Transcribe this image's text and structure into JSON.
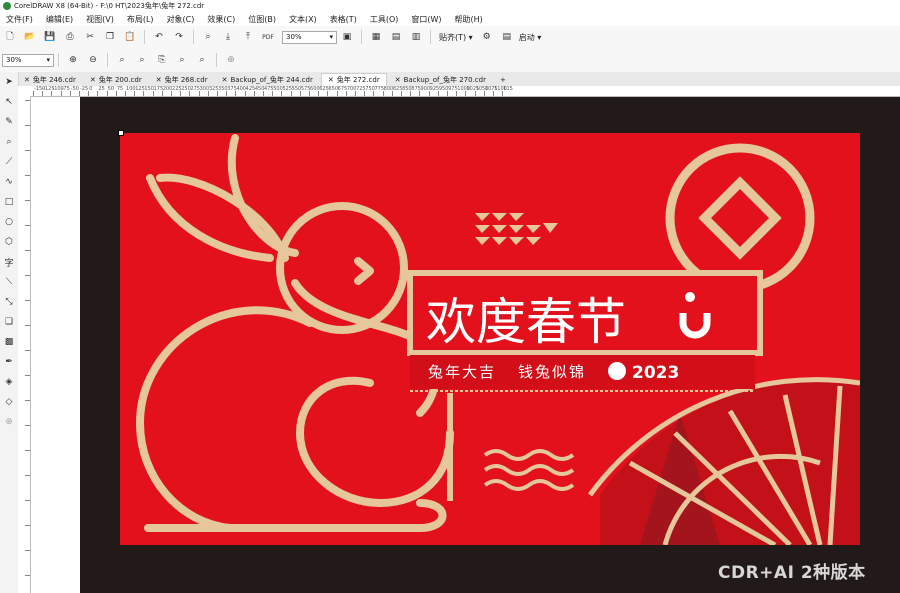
{
  "window": {
    "title": "CorelDRAW X8 (64-Bit) - F:\\0 HT\\2023兔年\\兔年 272.cdr"
  },
  "menu": [
    "文件(F)",
    "编辑(E)",
    "视图(V)",
    "布局(L)",
    "对象(C)",
    "效果(C)",
    "位图(B)",
    "文本(X)",
    "表格(T)",
    "工具(O)",
    "窗口(W)",
    "帮助(H)"
  ],
  "toolbar": {
    "zoom_value": "30%",
    "snap_label": "贴齐(T)",
    "launch_label": "启动",
    "pdf_label": "PDF"
  },
  "property_bar": {
    "zoom_value": "30%"
  },
  "tabs": [
    {
      "label": "兔年 246.cdr",
      "active": false
    },
    {
      "label": "兔年 200.cdr",
      "active": false
    },
    {
      "label": "兔年 268.cdr",
      "active": false
    },
    {
      "label": "Backup_of_兔年 244.cdr",
      "active": false
    },
    {
      "label": "兔年 272.cdr",
      "active": true
    },
    {
      "label": "Backup_of_兔年 270.cdr",
      "active": false
    }
  ],
  "ruler": {
    "ticks": [
      "-150",
      "-125",
      "-100",
      "-75",
      "-50",
      "-25",
      "0",
      "25",
      "50",
      "75",
      "100",
      "125",
      "150",
      "175",
      "200",
      "225",
      "250",
      "275",
      "300",
      "325",
      "350",
      "375",
      "400",
      "425",
      "450",
      "475",
      "500",
      "525",
      "550",
      "575",
      "600",
      "625",
      "650",
      "675",
      "700",
      "725",
      "750",
      "775",
      "800",
      "825",
      "850",
      "875",
      "900",
      "925",
      "950",
      "975",
      "1000",
      "1025",
      "1050",
      "1075",
      "1100",
      "115"
    ]
  },
  "artwork": {
    "headline": "欢度春节",
    "subline_left": "兔年大吉",
    "subline_right": "钱兔似锦",
    "year": "2023",
    "colors": {
      "red": "#e3111b",
      "gold": "#e6c79c",
      "dark_red": "#a3141c",
      "bg": "#221a18"
    }
  },
  "watermark": "CDR+AI 2种版本"
}
